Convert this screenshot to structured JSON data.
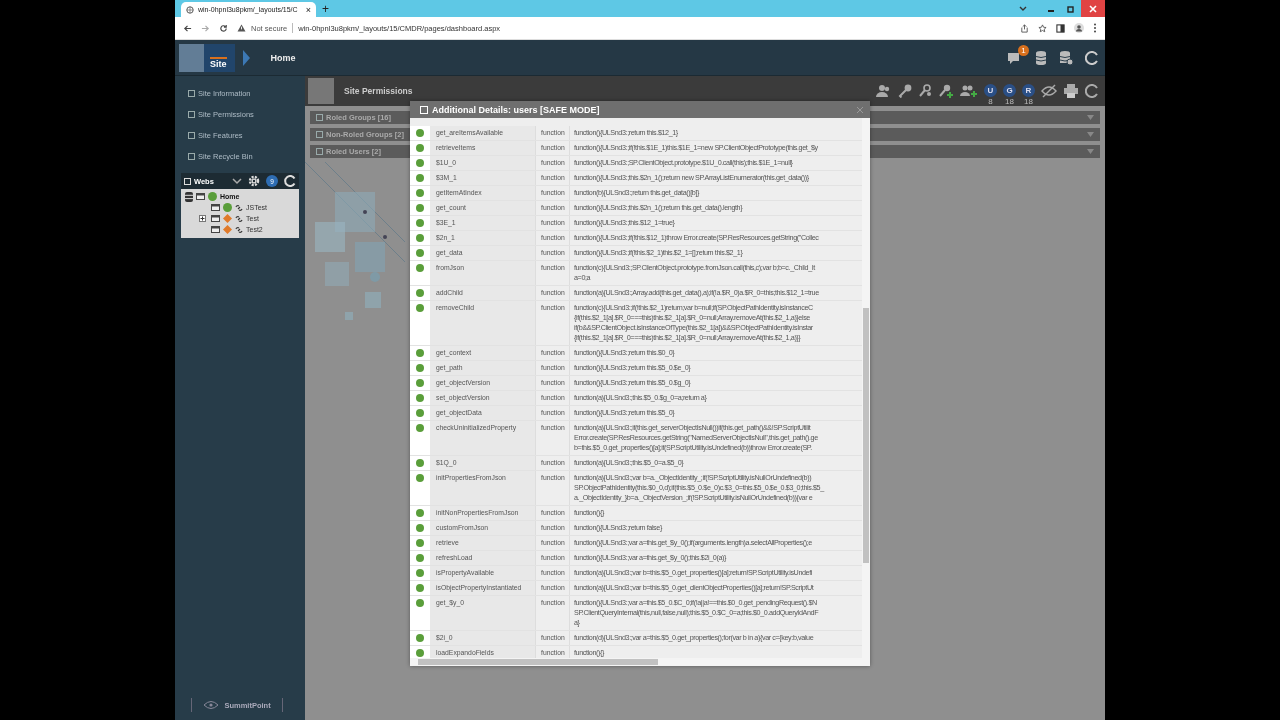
{
  "browser": {
    "tab_title": "win-0hpnl3u8pkm/_layouts/15/C",
    "tab_close": "×",
    "new_tab": "+",
    "security": "Not secure",
    "url": "win-0hpnl3u8pkm/_layouts/15/CMDR/pages/dashboard.aspx"
  },
  "header": {
    "site_label": "Site",
    "breadcrumb": "Home",
    "notification_count": "1"
  },
  "sidebar": {
    "items": [
      {
        "label": "Site Information"
      },
      {
        "label": "Site Permissions"
      },
      {
        "label": "Site Features"
      },
      {
        "label": "Site Recycle Bin"
      }
    ],
    "webs": {
      "title": "Webs",
      "count": "9",
      "tree": [
        {
          "label": "Home",
          "kind": "circle",
          "color": "#5a9e3a",
          "selected": true,
          "children": [
            {
              "label": "JSTest",
              "kind": "circle",
              "color": "#5a9e3a",
              "selected": false,
              "collapsed": false
            },
            {
              "label": "Test",
              "kind": "diamond",
              "color": "#e07a2a",
              "selected": false,
              "collapsed": true
            },
            {
              "label": "Test2",
              "kind": "diamond",
              "color": "#e07a2a",
              "selected": false,
              "collapsed": false
            }
          ]
        }
      ]
    },
    "footer": "SummitPoint"
  },
  "main": {
    "title": "Site Permissions",
    "counters": [
      {
        "letter": "U",
        "count": "8"
      },
      {
        "letter": "G",
        "count": "18"
      },
      {
        "letter": "R",
        "count": "18"
      }
    ],
    "sections": [
      {
        "label": "Roled Groups [16]"
      },
      {
        "label": "Non-Roled Groups [2]"
      },
      {
        "label": "Roled Users [2]"
      }
    ]
  },
  "dialog": {
    "title": "Additional Details: users [SAFE MODE]",
    "rows": [
      {
        "name": "get_areItemsAvailable",
        "type": "function",
        "value": [
          "function(){ULSnd3:;return this.$12_1}"
        ]
      },
      {
        "name": "retrieveItems",
        "type": "function",
        "value": [
          "function(){ULSnd3:;if(!this.$1E_1)this.$1E_1=new SP.ClientObjectPrototype(this.get_$y"
        ]
      },
      {
        "name": "$1U_0",
        "type": "function",
        "value": [
          "function(){ULSnd3:;SP.ClientObject.prototype.$1U_0.call(this);this.$1E_1=null}"
        ]
      },
      {
        "name": "$3M_1",
        "type": "function",
        "value": [
          "function(){ULSnd3:;this.$2n_1();return new SP.ArrayListEnumerator(this.get_data())}"
        ]
      },
      {
        "name": "getItemAtIndex",
        "type": "function",
        "value": [
          "function(b){ULSnd3:;return this.get_data()[b]}"
        ]
      },
      {
        "name": "get_count",
        "type": "function",
        "value": [
          "function(){ULSnd3:;this.$2n_1();return this.get_data().length}"
        ]
      },
      {
        "name": "$3E_1",
        "type": "function",
        "value": [
          "function(){ULSnd3:;this.$12_1=true}"
        ]
      },
      {
        "name": "$2n_1",
        "type": "function",
        "value": [
          "function(){ULSnd3:;if(!this.$12_1)throw Error.create(SP.ResResources.getString(\"Collec"
        ]
      },
      {
        "name": "get_data",
        "type": "function",
        "value": [
          "function(){ULSnd3:;if(!this.$2_1)this.$2_1=[];return this.$2_1}"
        ]
      },
      {
        "name": "fromJson",
        "type": "function",
        "value": [
          "function(c){ULSnd3:;SP.ClientObject.prototype.fromJson.call(this,c);var b;b=c._Child_It",
          "a=0;a"
        ]
      },
      {
        "name": "addChild",
        "type": "function",
        "value": [
          "function(a){ULSnd3:;Array.add(this.get_data(),a);if(!a.$R_0)a.$R_0=this;this.$12_1=true"
        ]
      },
      {
        "name": "removeChild",
        "type": "function",
        "value": [
          "function(c){ULSnd3:;if(!this.$2_1)return;var b=null;if(SP.ObjectPathIdentity.isInstanceC",
          "{if(this.$2_1[a].$R_0===this)this.$2_1[a].$R_0=null;Array.removeAt(this.$2_1,a)}else",
          "if(b&&SP.ClientObject.isInstanceOfType(this.$2_1[a])&&SP.ObjectPathIdentity.isInstar",
          "{if(this.$2_1[a].$R_0===this)this.$2_1[a].$R_0=null;Array.removeAt(this.$2_1,a)}}"
        ]
      },
      {
        "name": "get_context",
        "type": "function",
        "value": [
          "function(){ULSnd3:;return this.$0_0}"
        ]
      },
      {
        "name": "get_path",
        "type": "function",
        "value": [
          "function(){ULSnd3:;return this.$5_0.$e_0}"
        ]
      },
      {
        "name": "get_objectVersion",
        "type": "function",
        "value": [
          "function(){ULSnd3:;return this.$5_0.$g_0}"
        ]
      },
      {
        "name": "set_objectVersion",
        "type": "function",
        "value": [
          "function(a){ULSnd3:;this.$5_0.$g_0=a;return a}"
        ]
      },
      {
        "name": "get_objectData",
        "type": "function",
        "value": [
          "function(){ULSnd3:;return this.$5_0}"
        ]
      },
      {
        "name": "checkUninitializedProperty",
        "type": "function",
        "value": [
          "function(a){ULSnd3:;if(this.get_serverObjectIsNull())if(this.get_path()&&!SP.ScriptUtilit",
          "Error.create(SP.ResResources.getString(\"NamedServerObjectIsNull\",this.get_path().ge",
          "b=this.$5_0.get_properties()[a];if(SP.ScriptUtility.isUndefined(b))throw Error.create(SP."
        ]
      },
      {
        "name": "$1Q_0",
        "type": "function",
        "value": [
          "function(a){ULSnd3:;this.$5_0=a.$5_0}"
        ]
      },
      {
        "name": "initPropertiesFromJson",
        "type": "function",
        "value": [
          "function(a){ULSnd3:;var b=a._ObjectIdentity_;if(!SP.ScriptUtility.isNullOrUndefined(b))",
          "SP.ObjectPathIdentity(this.$0_0,d);if(this.$5_0.$e_0)c.$3_0=this.$5_0.$e_0.$3_0;this.$5_",
          "a._ObjectIdentity_}b=a._ObjectVersion_;if(!SP.ScriptUtility.isNullOrUndefined(b)){var e"
        ]
      },
      {
        "name": "initNonPropertiesFromJson",
        "type": "function",
        "value": [
          "function(){}"
        ]
      },
      {
        "name": "customFromJson",
        "type": "function",
        "value": [
          "function(){ULSnd3:;return false}"
        ]
      },
      {
        "name": "retrieve",
        "type": "function",
        "value": [
          "function(){ULSnd3:;var a=this.get_$y_0();if(arguments.length)a.selectAllProperties();e"
        ]
      },
      {
        "name": "refreshLoad",
        "type": "function",
        "value": [
          "function(){ULSnd3:;var a=this.get_$y_0();this.$2i_0(a)}"
        ]
      },
      {
        "name": "isPropertyAvailable",
        "type": "function",
        "value": [
          "function(a){ULSnd3:;var b=this.$5_0.get_properties()[a];return!SP.ScriptUtility.isUndefi"
        ]
      },
      {
        "name": "isObjectPropertyInstantiated",
        "type": "function",
        "value": [
          "function(a){ULSnd3:;var b=this.$5_0.get_clientObjectProperties()[a];return!SP.ScriptUt"
        ]
      },
      {
        "name": "get_$y_0",
        "type": "function",
        "value": [
          "function(){ULSnd3:;var a=this.$5_0.$C_0;if(!a||a!==this.$0_0.get_pendingRequest().$N",
          "SP.ClientQueryInternal(this,null,false,null);this.$5_0.$C_0=a;this.$0_0.addQueryIdAndF",
          "a}"
        ]
      },
      {
        "name": "$2i_0",
        "type": "function",
        "value": [
          "function(d){ULSnd3:;var a=this.$5_0.get_properties();for(var b in a){var c={key:b,value"
        ]
      },
      {
        "name": "loadExpandoFields",
        "type": "function",
        "value": [
          "function(){}"
        ]
      }
    ]
  }
}
